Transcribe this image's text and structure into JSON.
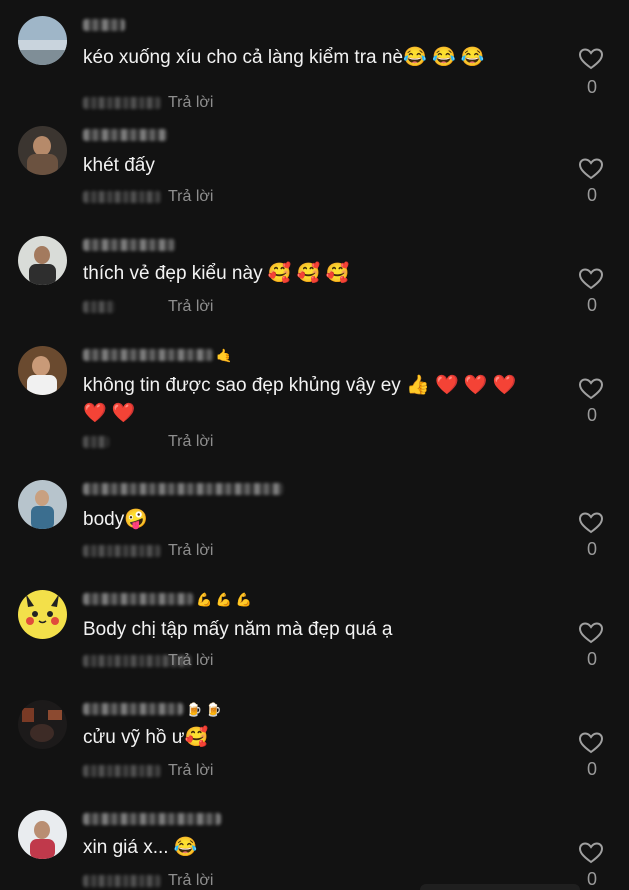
{
  "comments": [
    {
      "text": "kéo xuống xíu cho cả làng kiểm tra nè😂 😂 😂",
      "reply": "Trả lời",
      "likes": "0"
    },
    {
      "text": "khét đấy",
      "reply": "Trả lời",
      "likes": "0"
    },
    {
      "text": "thích vẻ đẹp kiểu này 🥰 🥰 🥰",
      "reply": "Trả lời",
      "likes": "0"
    },
    {
      "text": "không tin được sao đẹp khủng vậy ey 👍 ❤️ ❤️ ❤️ ❤️ ❤️",
      "reply": "Trả lời",
      "likes": "0"
    },
    {
      "text": "body🤪",
      "reply": "Trả lời",
      "likes": "0"
    },
    {
      "text": "Body chị tập mấy năm mà đẹp quá ạ",
      "reply": "Trả lời",
      "likes": "0"
    },
    {
      "text": "cửu vỹ hồ ư🥰",
      "reply": "Trả lời",
      "likes": "0"
    },
    {
      "text": "xin giá x... 😂",
      "reply": "Trả lời",
      "likes": "0"
    }
  ],
  "icons": {
    "like": "heart-outline-icon",
    "avatar_pikachu": "pikachu-avatar"
  },
  "colors": {
    "background": "#121212",
    "text": "#f2f2f2",
    "muted": "#8e8e8e",
    "like_count": "#9a9a9a"
  }
}
